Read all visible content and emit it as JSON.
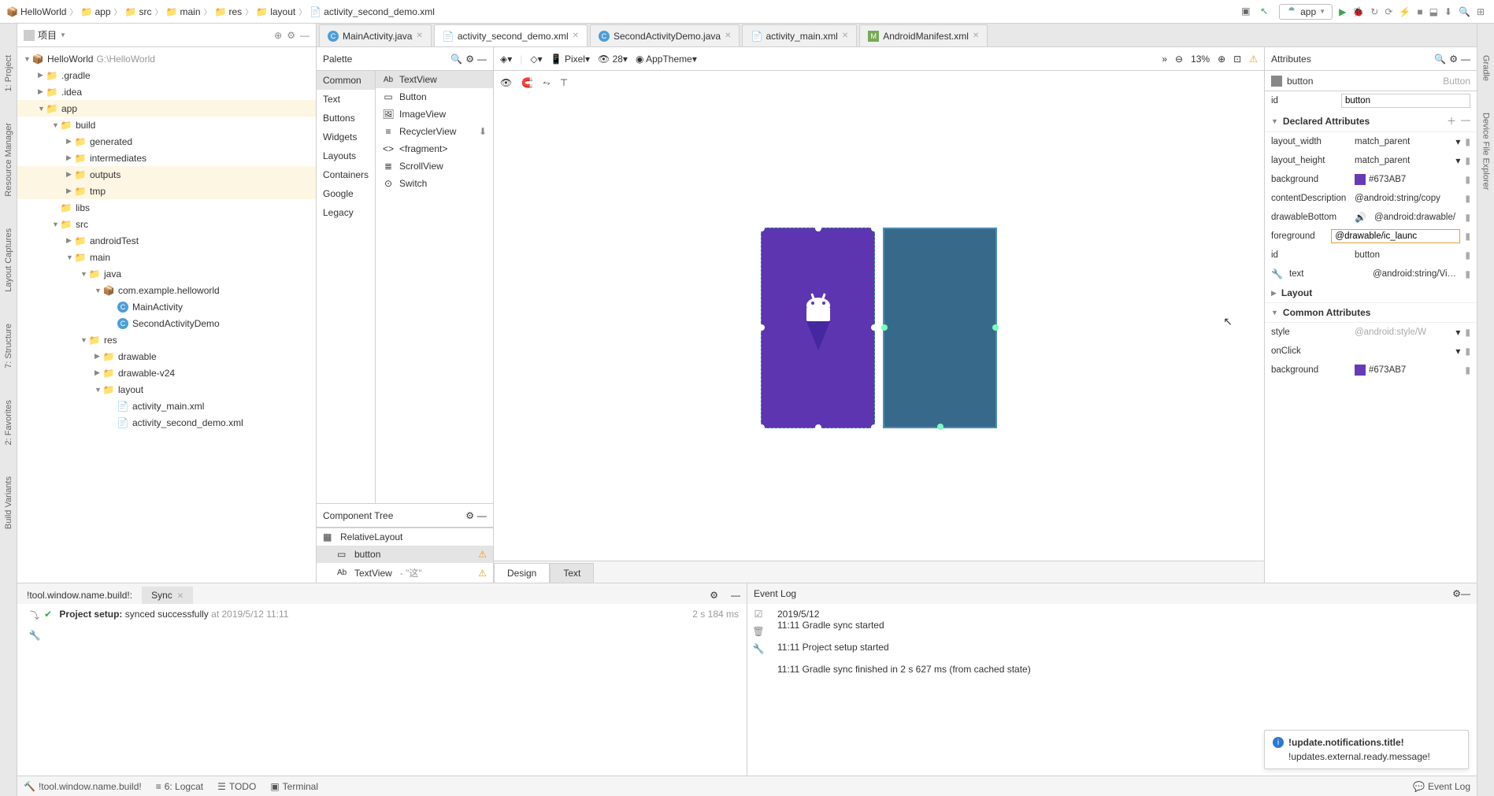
{
  "breadcrumb": [
    {
      "icon": "project",
      "label": "HelloWorld"
    },
    {
      "icon": "folder",
      "label": "app"
    },
    {
      "icon": "folder",
      "label": "src"
    },
    {
      "icon": "folder",
      "label": "main"
    },
    {
      "icon": "folder",
      "label": "res"
    },
    {
      "icon": "folder",
      "label": "layout"
    },
    {
      "icon": "xml",
      "label": "activity_second_demo.xml"
    }
  ],
  "topbar": {
    "appLabel": "app"
  },
  "project": {
    "title": "项目",
    "rootName": "HelloWorld",
    "rootPath": "G:\\HelloWorld",
    "items": [
      {
        "d": 0,
        "chev": "down",
        "icon": "project",
        "name": "HelloWorld",
        "meta": "G:\\HelloWorld"
      },
      {
        "d": 1,
        "chev": "right",
        "icon": "folder",
        "name": ".gradle"
      },
      {
        "d": 1,
        "chev": "right",
        "icon": "folder",
        "name": ".idea"
      },
      {
        "d": 1,
        "chev": "down",
        "icon": "folder",
        "name": "app",
        "sel": true
      },
      {
        "d": 2,
        "chev": "down",
        "icon": "folder",
        "name": "build"
      },
      {
        "d": 3,
        "chev": "right",
        "icon": "folder",
        "name": "generated"
      },
      {
        "d": 3,
        "chev": "right",
        "icon": "folder",
        "name": "intermediates"
      },
      {
        "d": 3,
        "chev": "right",
        "icon": "folder",
        "name": "outputs",
        "sel": true
      },
      {
        "d": 3,
        "chev": "right",
        "icon": "folder",
        "name": "tmp",
        "sel": true
      },
      {
        "d": 2,
        "chev": "",
        "icon": "folder",
        "name": "libs"
      },
      {
        "d": 2,
        "chev": "down",
        "icon": "folder",
        "name": "src"
      },
      {
        "d": 3,
        "chev": "right",
        "icon": "folder",
        "name": "androidTest"
      },
      {
        "d": 3,
        "chev": "down",
        "icon": "folder",
        "name": "main"
      },
      {
        "d": 4,
        "chev": "down",
        "icon": "folder-blue",
        "name": "java"
      },
      {
        "d": 5,
        "chev": "down",
        "icon": "pkg",
        "name": "com.example.helloworld"
      },
      {
        "d": 6,
        "chev": "",
        "icon": "class",
        "name": "MainActivity"
      },
      {
        "d": 6,
        "chev": "",
        "icon": "class",
        "name": "SecondActivityDemo"
      },
      {
        "d": 4,
        "chev": "down",
        "icon": "folder",
        "name": "res"
      },
      {
        "d": 5,
        "chev": "right",
        "icon": "folder",
        "name": "drawable"
      },
      {
        "d": 5,
        "chev": "right",
        "icon": "folder",
        "name": "drawable-v24"
      },
      {
        "d": 5,
        "chev": "down",
        "icon": "folder",
        "name": "layout"
      },
      {
        "d": 6,
        "chev": "",
        "icon": "xml",
        "name": "activity_main.xml"
      },
      {
        "d": 6,
        "chev": "",
        "icon": "xml",
        "name": "activity_second_demo.xml"
      }
    ]
  },
  "tabs": [
    {
      "icon": "class",
      "label": "MainActivity.java",
      "active": false
    },
    {
      "icon": "xml",
      "label": "activity_second_demo.xml",
      "active": true
    },
    {
      "icon": "class",
      "label": "SecondActivityDemo.java",
      "active": false
    },
    {
      "icon": "xml",
      "label": "activity_main.xml",
      "active": false
    },
    {
      "icon": "manifest",
      "label": "AndroidManifest.xml",
      "active": false
    }
  ],
  "palette": {
    "title": "Palette",
    "cats": [
      "Common",
      "Text",
      "Buttons",
      "Widgets",
      "Layouts",
      "Containers",
      "Google",
      "Legacy"
    ],
    "activeCat": "Common",
    "items": [
      {
        "icon": "Ab",
        "label": "TextView",
        "sel": true
      },
      {
        "icon": "btn",
        "label": "Button"
      },
      {
        "icon": "img",
        "label": "ImageView"
      },
      {
        "icon": "list",
        "label": "RecyclerView"
      },
      {
        "icon": "frag",
        "label": "<fragment>"
      },
      {
        "icon": "scroll",
        "label": "ScrollView"
      },
      {
        "icon": "switch",
        "label": "Switch"
      }
    ]
  },
  "componentTree": {
    "title": "Component Tree",
    "items": [
      {
        "d": 0,
        "icon": "layout",
        "label": "RelativeLayout",
        "warn": false
      },
      {
        "d": 1,
        "icon": "btn",
        "label": "button",
        "warn": true,
        "sel": true
      },
      {
        "d": 1,
        "icon": "Ab",
        "label": "TextView",
        "extra": "- \"这\"",
        "warn": true
      }
    ]
  },
  "canvas": {
    "deviceLabel": "Pixel",
    "apiLabel": "28",
    "themeLabel": "AppTheme",
    "zoom": "13%"
  },
  "designTabs": {
    "design": "Design",
    "text": "Text"
  },
  "attributes": {
    "title": "Attributes",
    "compLabel": "button",
    "compType": "Button",
    "idLabel": "id",
    "idVal": "button",
    "declared": "Declared Attributes",
    "layout": "Layout",
    "common": "Common Attributes",
    "rows": {
      "layout_width": {
        "name": "layout_width",
        "val": "match_parent"
      },
      "layout_height": {
        "name": "layout_height",
        "val": "match_parent"
      },
      "background": {
        "name": "background",
        "val": "#673AB7",
        "color": "#673AB7"
      },
      "contentDescription": {
        "name": "contentDescription",
        "val": "@android:string/copy"
      },
      "drawableBottom": {
        "name": "drawableBottom",
        "val": "@android:drawable/"
      },
      "foreground": {
        "name": "foreground",
        "val": "@drawable/ic_launc"
      },
      "id2": {
        "name": "id",
        "val": "button"
      },
      "text": {
        "name": "text",
        "val": "@android:string/Video"
      },
      "style": {
        "name": "style",
        "val": "@android:style/W"
      },
      "onClick": {
        "name": "onClick",
        "val": ""
      },
      "background2": {
        "name": "background",
        "val": "#673AB7",
        "color": "#673AB7"
      }
    }
  },
  "build": {
    "tab1": "!tool.window.name.build!:",
    "tab2": "Sync",
    "msgBold": "Project setup:",
    "msg": "synced successfully",
    "at": "at 2019/5/12 11:11",
    "dur": "2 s 184 ms"
  },
  "eventlog": {
    "title": "Event Log",
    "date": "2019/5/12",
    "l1": "11:11 Gradle sync started",
    "l2": "11:11 Project setup started",
    "l3": "11:11 Gradle sync finished in 2 s 627 ms (from cached state)"
  },
  "notif": {
    "title": "!update.notifications.title!",
    "msg": "!updates.external.ready.message!"
  },
  "bottombar": {
    "build": "!tool.window.name.build!",
    "logcat": "6: Logcat",
    "todo": "TODO",
    "terminal": "Terminal",
    "eventlog": "Event Log"
  },
  "leftstripe": {
    "project": "1: Project",
    "resmgr": "Resource Manager",
    "structure": "7: Structure",
    "favorites": "2: Favorites",
    "buildvar": "Build Variants",
    "captures": "Layout Captures"
  },
  "rightstripe": {
    "gradle": "Gradle",
    "devfile": "Device File Explorer"
  }
}
